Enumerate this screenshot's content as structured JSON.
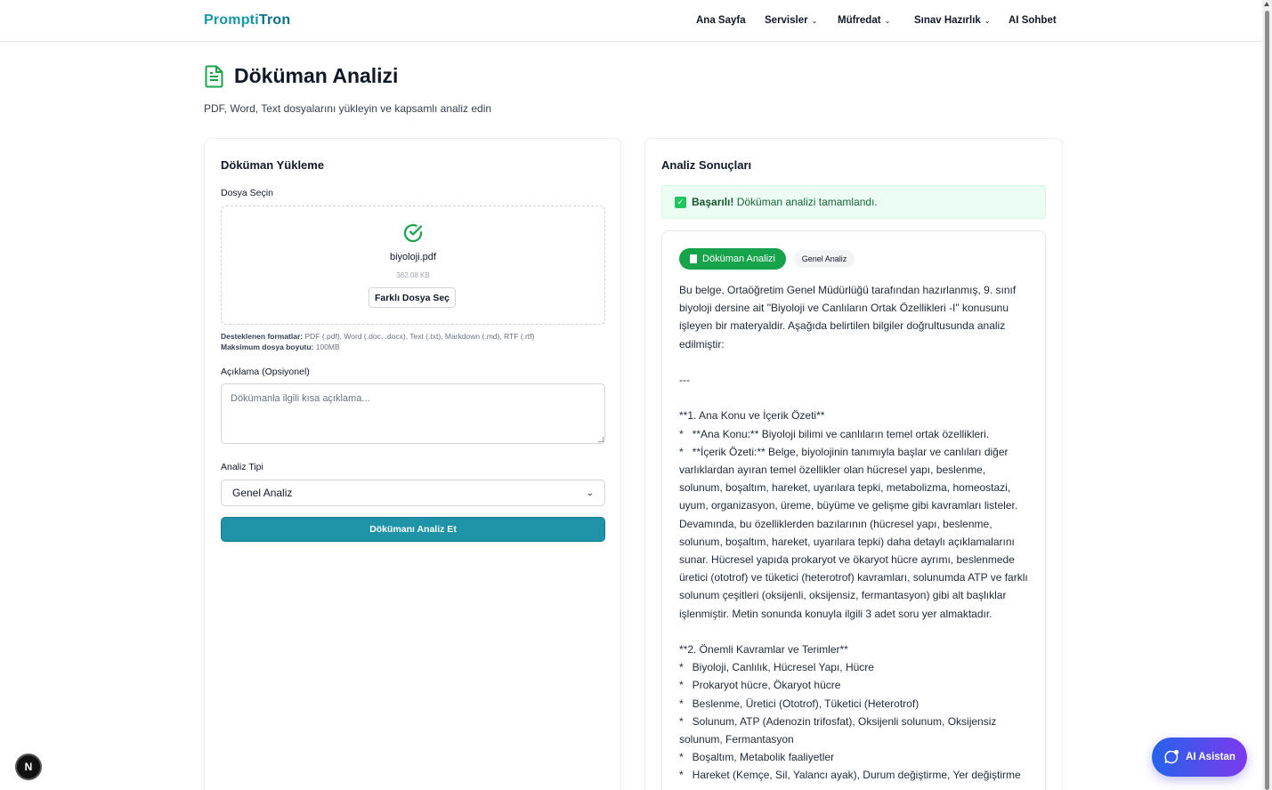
{
  "nav": {
    "brand_a": "Prompti",
    "brand_b": "Tron",
    "items": [
      {
        "label": "Ana Sayfa",
        "dropdown": false
      },
      {
        "label": "Servisler",
        "dropdown": true
      },
      {
        "label": "Müfredat",
        "dropdown": true
      },
      {
        "label": "Sınav Hazırlık",
        "dropdown": true
      },
      {
        "label": "AI Sohbet",
        "dropdown": false
      }
    ]
  },
  "header": {
    "title": "Döküman Analizi",
    "subtitle": "PDF, Word, Text dosyalarını yükleyin ve kapsamlı analiz edin"
  },
  "upload": {
    "card_title": "Döküman Yükleme",
    "file_label": "Dosya Seçin",
    "file_name": "biyoloji.pdf",
    "file_size": "382.08 KB",
    "change_button": "Farklı Dosya Seç",
    "formats_label": "Desteklenen formatlar:",
    "formats_value": " PDF (.pdf), Word (.doc, .docx), Text (.txt), Markdown (.md), RTF (.rtf)",
    "maxsize_label": "Maksimum dosya boyutu:",
    "maxsize_value": " 100MB",
    "desc_label": "Açıklama (Opsiyonel)",
    "desc_placeholder": "Dökümanla ilgili kısa açıklama...",
    "type_label": "Analiz Tipi",
    "type_value": "Genel Analiz",
    "analyze_button": "Dökümanı Analiz Et"
  },
  "results": {
    "card_title": "Analiz Sonuçları",
    "alert_strong": "Başarılı!",
    "alert_text": " Döküman analizi tamamlandı.",
    "tab_active": "Döküman Analizi",
    "tab_other": "Genel Analiz",
    "text": "Bu belge, Ortaöğretim Genel Müdürlüğü tarafından hazırlanmış, 9. sınıf biyoloji dersine ait \"Biyoloji ve Canlıların Ortak Özellikleri -I\" konusunu işleyen bir materyaldir. Aşağıda belirtilen bilgiler doğrultusunda analiz edilmiştir:\n\n---\n\n**1. Ana Konu ve İçerik Özeti**\n*   **Ana Konu:** Biyoloji bilimi ve canlıların temel ortak özellikleri.\n*   **İçerik Özeti:** Belge, biyolojinin tanımıyla başlar ve canlıları diğer varlıklardan ayıran temel özellikler olan hücresel yapı, beslenme, solunum, boşaltım, hareket, uyarılara tepki, metabolizma, homeostazi, uyum, organizasyon, üreme, büyüme ve gelişme gibi kavramları listeler. Devamında, bu özelliklerden bazılarının (hücresel yapı, beslenme, solunum, boşaltım, hareket, uyarılara tepki) daha detaylı açıklamalarını sunar. Hücresel yapıda prokaryot ve ökaryot hücre ayrımı, beslenmede üretici (ototrof) ve tüketici (heterotrof) kavramları, solunumda ATP ve farklı solunum çeşitleri (oksijenli, oksijensiz, fermantasyon) gibi alt başlıklar işlenmiştir. Metin sonunda konuyla ilgili 3 adet soru yer almaktadır.\n\n**2. Önemli Kavramlar ve Terimler**\n*   Biyoloji, Canlılık, Hücresel Yapı, Hücre\n*   Prokaryot hücre, Ökaryot hücre\n*   Beslenme, Üretici (Ototrof), Tüketici (Heterotrof)\n*   Solunum, ATP (Adenozin trifosfat), Oksijenli solunum, Oksijensiz solunum, Fermantasyon\n*   Boşaltım, Metabolik faaliyetler\n*   Hareket (Kemçe, Sil, Yalancı ayak), Durum değiştirme, Yer değiştirme"
  },
  "floating": {
    "badge": "N",
    "assistant": "AI Asistan"
  },
  "colors": {
    "brand_light": "#1597a9",
    "brand_dark": "#0f6e86",
    "primary_button": "#1f94a8",
    "success": "#16a34a",
    "assistant_from": "#2563eb",
    "assistant_to": "#7c3aed"
  }
}
